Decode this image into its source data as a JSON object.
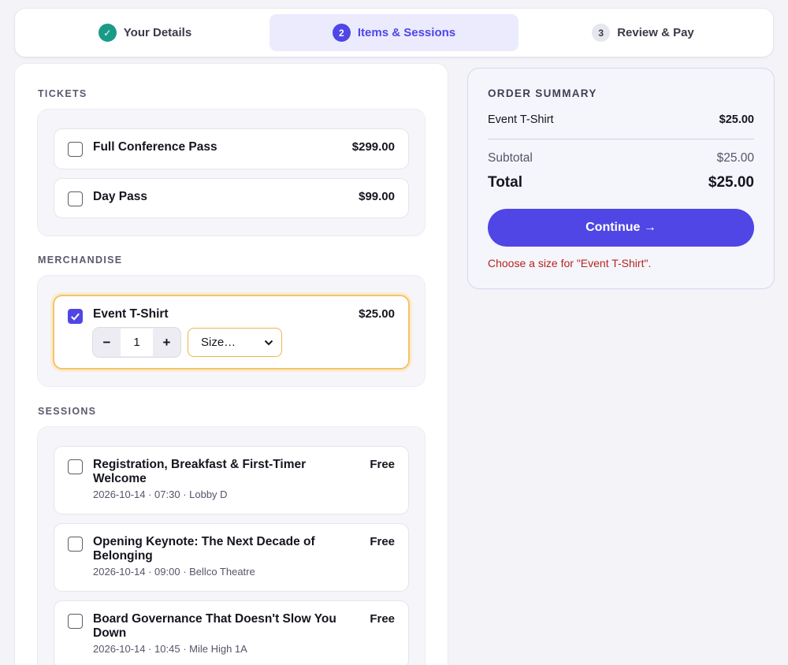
{
  "steps": [
    {
      "num": "✓",
      "label": "Your Details",
      "state": "done"
    },
    {
      "num": "2",
      "label": "Items & Sessions",
      "state": "current"
    },
    {
      "num": "3",
      "label": "Review & Pay",
      "state": "pending"
    }
  ],
  "sections": {
    "tickets": "TICKETS",
    "merchandise": "MERCHANDISE",
    "sessions": "SESSIONS"
  },
  "tickets": [
    {
      "name": "Full Conference Pass",
      "price": "$299.00",
      "checked": false
    },
    {
      "name": "Day Pass",
      "price": "$99.00",
      "checked": false
    }
  ],
  "merch": [
    {
      "name": "Event T-Shirt",
      "price": "$25.00",
      "checked": true,
      "qty_minus": "−",
      "qty": "1",
      "qty_plus": "+",
      "size_selected": "Size…"
    }
  ],
  "sessions": [
    {
      "name": "Registration, Breakfast & First-Timer Welcome",
      "price": "Free",
      "meta": "2026-10-14 · 07:30 · Lobby D",
      "checked": false
    },
    {
      "name": "Opening Keynote: The Next Decade of Belonging",
      "price": "Free",
      "meta": "2026-10-14 · 09:00 · Bellco Theatre",
      "checked": false
    },
    {
      "name": "Board Governance That Doesn't Slow You Down",
      "price": "Free",
      "meta": "2026-10-14 · 10:45 · Mile High 1A",
      "checked": false
    }
  ],
  "summary": {
    "title": "ORDER SUMMARY",
    "line_item_name": "Event T-Shirt",
    "line_item_price": "$25.00",
    "subtotal_label": "Subtotal",
    "subtotal_value": "$25.00",
    "total_label": "Total",
    "total_value": "$25.00",
    "continue_label": "Continue →",
    "error": "Choose a size for \"Event T-Shirt\"."
  },
  "colors": {
    "accent": "#4f46e5",
    "done": "#1a9b8a",
    "error": "#b3261e",
    "highlight": "#f2c46b"
  }
}
